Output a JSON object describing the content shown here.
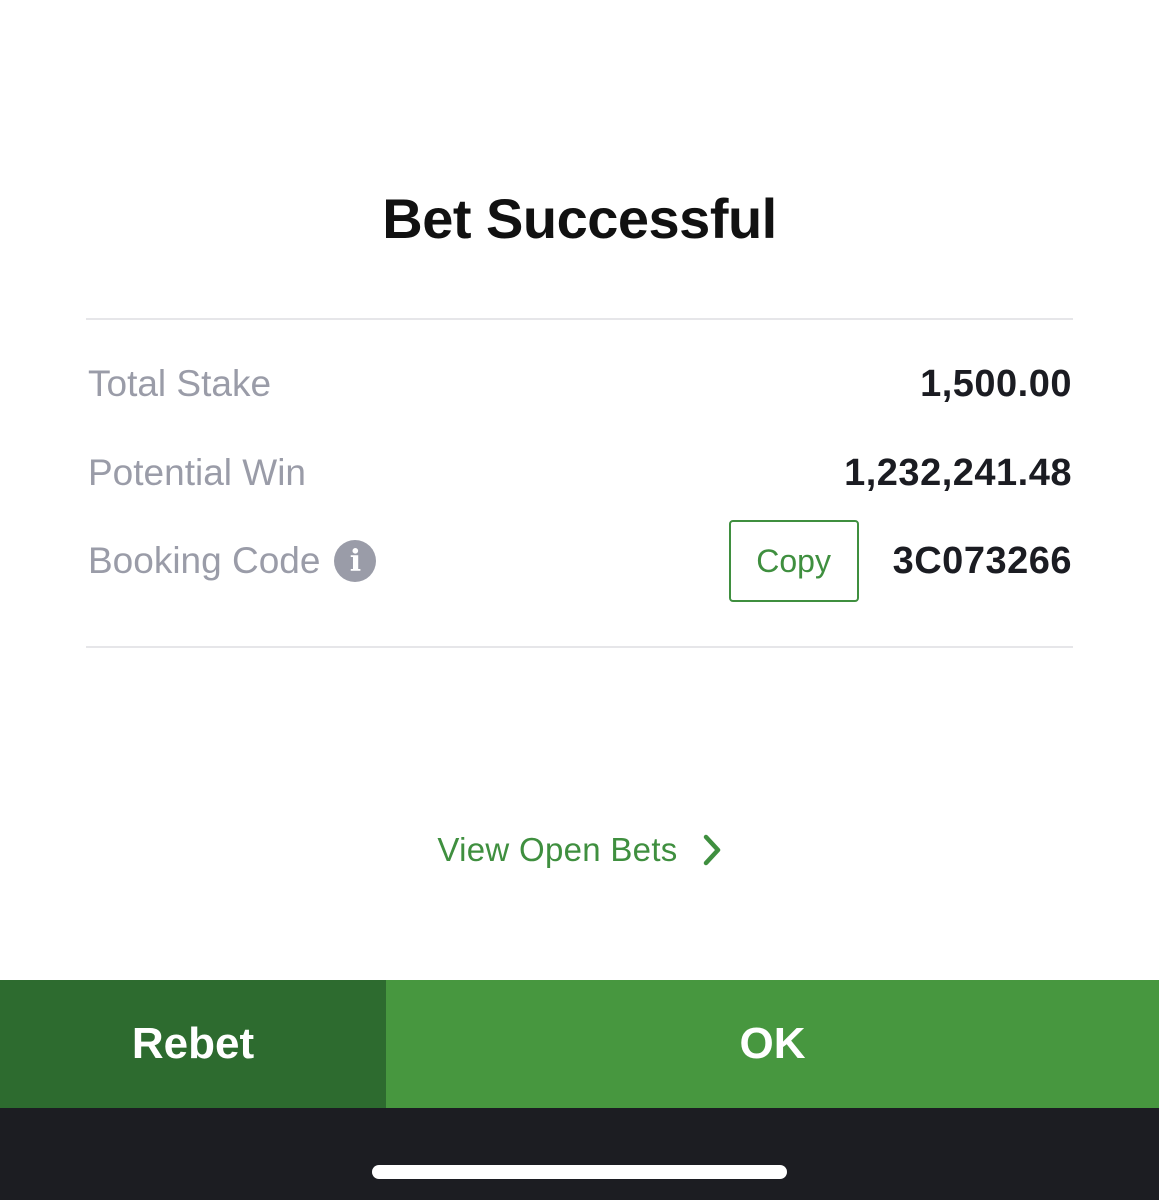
{
  "dialog": {
    "title": "Bet Successful"
  },
  "details": {
    "total_stake": {
      "label": "Total Stake",
      "value": "1,500.00"
    },
    "potential_win": {
      "label": "Potential Win",
      "value": "1,232,241.48"
    },
    "booking_code": {
      "label": "Booking Code",
      "value": "3C073266",
      "copy_label": "Copy",
      "info_icon": "info-icon"
    }
  },
  "links": {
    "view_open_bets": "View Open Bets",
    "chevron_icon": "chevron-right-icon"
  },
  "actions": {
    "rebet_label": "Rebet",
    "ok_label": "OK"
  },
  "colors": {
    "accent_green": "#47973f",
    "dark_green": "#2d6b2f",
    "label_gray": "#9a9ca8"
  }
}
